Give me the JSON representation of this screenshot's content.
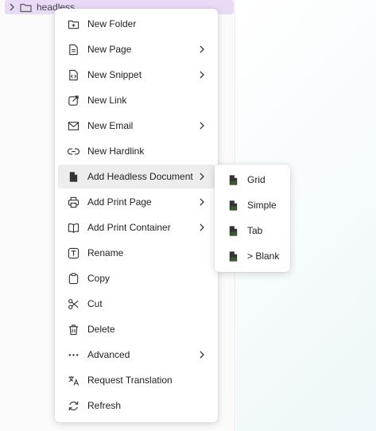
{
  "tree": {
    "folder_label": "headless"
  },
  "menu": {
    "items": [
      {
        "label": "New Folder",
        "icon": "folder-plus-icon",
        "has_submenu": false
      },
      {
        "label": "New Page",
        "icon": "file-text-icon",
        "has_submenu": true
      },
      {
        "label": "New Snippet",
        "icon": "file-code-icon",
        "has_submenu": true
      },
      {
        "label": "New Link",
        "icon": "link-external-icon",
        "has_submenu": false
      },
      {
        "label": "New Email",
        "icon": "mail-icon",
        "has_submenu": true
      },
      {
        "label": "New Hardlink",
        "icon": "link-icon",
        "has_submenu": false
      },
      {
        "label": "Add Headless Document",
        "icon": "document-icon",
        "has_submenu": true,
        "active": true
      },
      {
        "label": "Add Print Page",
        "icon": "printer-icon",
        "has_submenu": true
      },
      {
        "label": "Add Print Container",
        "icon": "book-icon",
        "has_submenu": true
      },
      {
        "label": "Rename",
        "icon": "text-icon",
        "has_submenu": false
      },
      {
        "label": "Copy",
        "icon": "clipboard-icon",
        "has_submenu": false
      },
      {
        "label": "Cut",
        "icon": "scissors-icon",
        "has_submenu": false
      },
      {
        "label": "Delete",
        "icon": "trash-icon",
        "has_submenu": false
      },
      {
        "label": "Advanced",
        "icon": "dots-icon",
        "has_submenu": true
      },
      {
        "label": "Request Translation",
        "icon": "translate-icon",
        "has_submenu": false
      },
      {
        "label": "Refresh",
        "icon": "refresh-icon",
        "has_submenu": false
      }
    ]
  },
  "submenu": {
    "items": [
      {
        "label": "Grid",
        "icon": "document-icon"
      },
      {
        "label": "Simple",
        "icon": "document-icon"
      },
      {
        "label": "Tab",
        "icon": "document-icon"
      },
      {
        "label": "> Blank",
        "icon": "document-icon"
      }
    ]
  },
  "colors": {
    "selected_row": "#e9dbf8",
    "doc_icon_accent": "#3b5b2a"
  }
}
